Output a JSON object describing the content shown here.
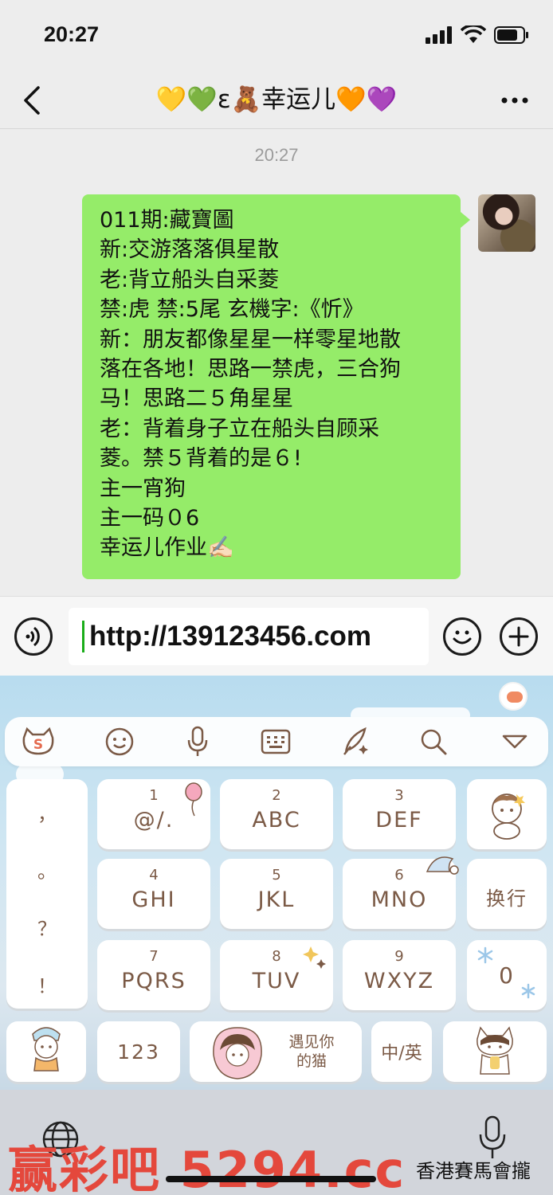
{
  "status_bar": {
    "time": "20:27"
  },
  "chat": {
    "title": "💛💚ε🧸幸运儿🧡💜",
    "message_time": "20:27",
    "message_lines": [
      "011期:藏寶圖",
      "新:交游落落俱星散",
      "老:背立船头自采菱",
      "禁:虎 禁:5尾 玄機字:《忻》",
      "新：朋友都像星星一样零星地散",
      "落在各地！思路一禁虎，三合狗",
      "马！思路二５角星星",
      "老：背着身子立在船头自顾采",
      "菱。禁５背着的是６!",
      "主一宵狗",
      "主一码０6",
      "幸运儿作业✍🏻"
    ]
  },
  "input_bar": {
    "text": "http://139123456.com"
  },
  "keyboard": {
    "punctuation": [
      "，",
      "。",
      "？",
      "！"
    ],
    "keys": [
      {
        "num": "1",
        "label": "@/."
      },
      {
        "num": "2",
        "label": "ABC"
      },
      {
        "num": "3",
        "label": "DEF"
      },
      {
        "num": "4",
        "label": "GHI"
      },
      {
        "num": "5",
        "label": "JKL"
      },
      {
        "num": "6",
        "label": "MNO"
      },
      {
        "num": "7",
        "label": "PQRS"
      },
      {
        "num": "8",
        "label": "TUV"
      },
      {
        "num": "9",
        "label": "WXYZ"
      }
    ],
    "newline_label": "换行",
    "zero_label": "0",
    "num_mode_label": "123",
    "space_sticker_text": "遇见你的猫",
    "lang_switch_label": "中/英"
  },
  "watermark": {
    "left": "赢彩吧  5294.cc",
    "right": "香港賽馬會攏"
  },
  "colors": {
    "bubble": "#95ec69",
    "chat_bg": "#ededed",
    "key_text": "#7b5a46",
    "watermark": "#e4483c"
  }
}
